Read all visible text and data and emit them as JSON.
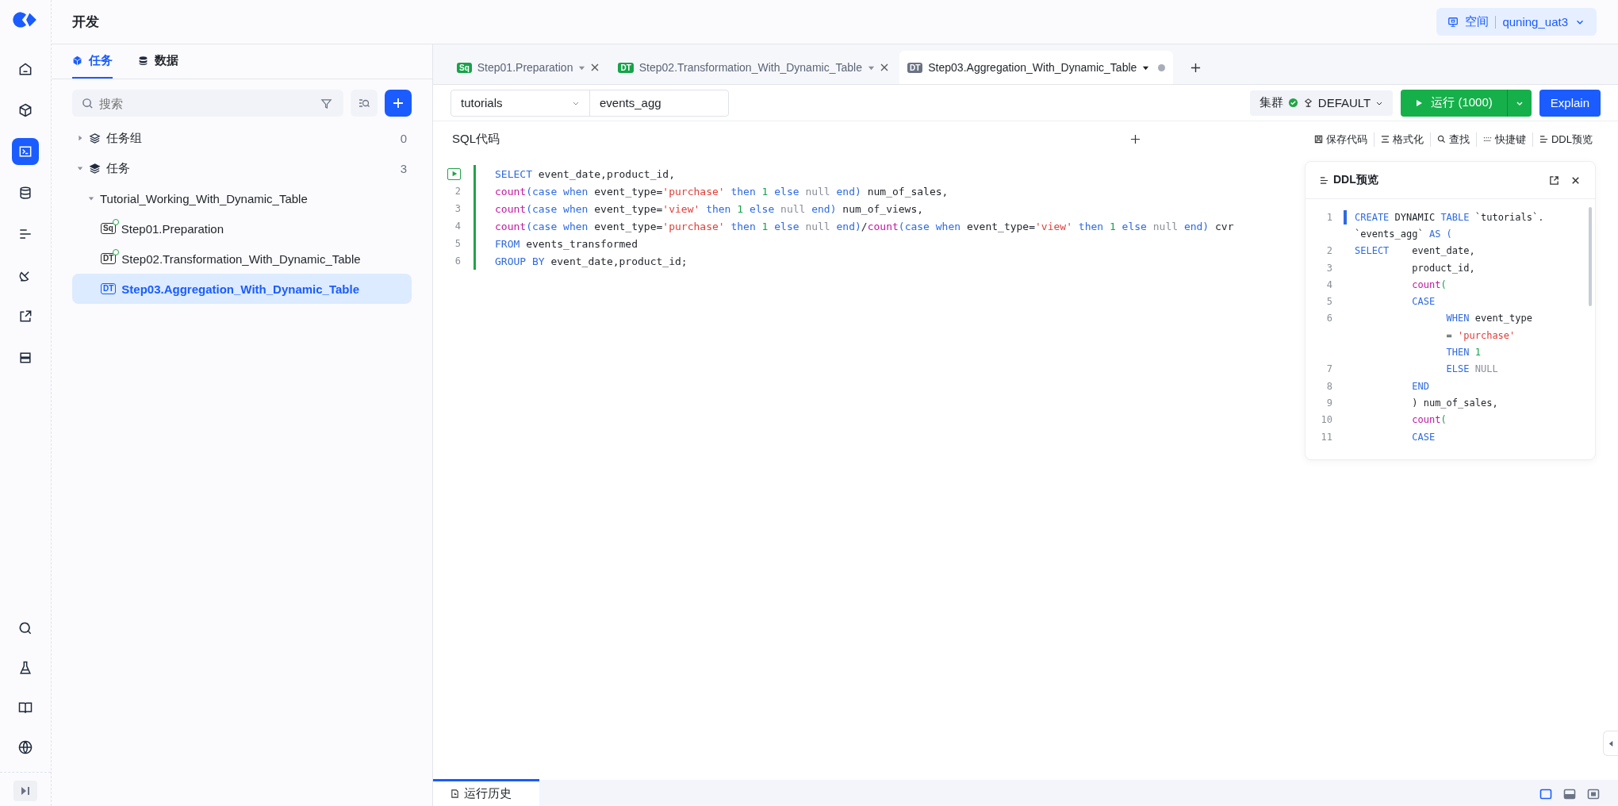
{
  "header": {
    "title": "开发",
    "workspace_label": "空间",
    "workspace_user": "quning_uat3"
  },
  "rail": [
    {
      "selected": false
    },
    {
      "selected": false
    },
    {
      "selected": true
    },
    {
      "selected": false
    },
    {
      "selected": false
    },
    {
      "selected": false
    },
    {
      "selected": false
    },
    {
      "selected": false
    }
  ],
  "rail_bottom": [
    {
      "selected": false
    },
    {
      "selected": false
    },
    {
      "selected": false
    },
    {
      "selected": false
    }
  ],
  "panel_tabs": [
    {
      "label": "任务",
      "selected": true
    },
    {
      "label": "数据",
      "selected": false
    }
  ],
  "search": {
    "placeholder": "搜索"
  },
  "tree": [
    {
      "label": "任务组",
      "count": "0",
      "expanded": false
    },
    {
      "label": "任务",
      "count": "3",
      "expanded": true,
      "children": [
        {
          "label": "Tutorial_Working_With_Dynamic_Table",
          "expanded": true,
          "children": [
            {
              "badge": "Sq",
              "label": "Step01.Preparation",
              "synced": true,
              "selected": false
            },
            {
              "badge": "DT",
              "label": "Step02.Transformation_With_Dynamic_Table",
              "synced": true,
              "selected": false
            },
            {
              "badge": "DT",
              "label": "Step03.Aggregation_With_Dynamic_Table",
              "synced": false,
              "selected": true
            }
          ]
        }
      ]
    }
  ],
  "editor_tabs": [
    {
      "badge": "Sq",
      "label": "Step01.Preparation",
      "selected": false,
      "modified": false
    },
    {
      "badge": "DT",
      "label": "Step02.Transformation_With_Dynamic_Table",
      "selected": false,
      "modified": false
    },
    {
      "badge": "DT",
      "label": "Step03.Aggregation_With_Dynamic_Table",
      "selected": true,
      "modified": true
    }
  ],
  "toolbar": {
    "schema": "tutorials",
    "table": "events_agg",
    "cluster_label": "集群",
    "cluster": "DEFAULT",
    "run": "运行 (1000)",
    "explain": "Explain"
  },
  "sql": {
    "title": "SQL代码",
    "actions": [
      "保存代码",
      "格式化",
      "查找",
      "快捷键",
      "DDL预览"
    ]
  },
  "code": [
    {
      "tokens": [
        {
          "kind": "kw",
          "text": "SELECT"
        },
        {
          "kind": "plain",
          "text": " event_date,product_id,"
        }
      ]
    },
    {
      "number": "2",
      "tokens": [
        {
          "kind": "fn",
          "text": "count"
        },
        {
          "kind": "kw",
          "text": "(case when"
        },
        {
          "kind": "plain",
          "text": " event_type="
        },
        {
          "kind": "str",
          "text": "'purchase'"
        },
        {
          "kind": "kw",
          "text": " then"
        },
        {
          "kind": "num",
          "text": " 1"
        },
        {
          "kind": "kw",
          "text": " else"
        },
        {
          "kind": "null",
          "text": " null"
        },
        {
          "kind": "kw",
          "text": " end)"
        },
        {
          "kind": "plain",
          "text": " num_of_sales,"
        }
      ]
    },
    {
      "number": "3",
      "tokens": [
        {
          "kind": "fn",
          "text": "count"
        },
        {
          "kind": "kw",
          "text": "(case when"
        },
        {
          "kind": "plain",
          "text": " event_type="
        },
        {
          "kind": "str",
          "text": "'view'"
        },
        {
          "kind": "kw",
          "text": " then"
        },
        {
          "kind": "num",
          "text": " 1"
        },
        {
          "kind": "kw",
          "text": " else"
        },
        {
          "kind": "null",
          "text": " null"
        },
        {
          "kind": "kw",
          "text": " end)"
        },
        {
          "kind": "plain",
          "text": " num_of_views,"
        }
      ]
    },
    {
      "number": "4",
      "tokens": [
        {
          "kind": "fn",
          "text": "count"
        },
        {
          "kind": "kw",
          "text": "(case when"
        },
        {
          "kind": "plain",
          "text": " event_type="
        },
        {
          "kind": "str",
          "text": "'purchase'"
        },
        {
          "kind": "kw",
          "text": " then"
        },
        {
          "kind": "num",
          "text": " 1"
        },
        {
          "kind": "kw",
          "text": " else"
        },
        {
          "kind": "null",
          "text": " null"
        },
        {
          "kind": "kw",
          "text": " end)"
        },
        {
          "kind": "plain",
          "text": "/"
        },
        {
          "kind": "fn",
          "text": "count"
        },
        {
          "kind": "kw",
          "text": "(case when"
        },
        {
          "kind": "plain",
          "text": " event_type="
        },
        {
          "kind": "str",
          "text": "'view'"
        },
        {
          "kind": "kw",
          "text": " then"
        },
        {
          "kind": "num",
          "text": " 1"
        },
        {
          "kind": "kw",
          "text": " else"
        },
        {
          "kind": "null",
          "text": " null"
        },
        {
          "kind": "kw",
          "text": " end)"
        },
        {
          "kind": "plain",
          "text": " cvr"
        }
      ]
    },
    {
      "number": "5",
      "tokens": [
        {
          "kind": "kw",
          "text": "FROM"
        },
        {
          "kind": "plain",
          "text": " events_transformed"
        }
      ]
    },
    {
      "number": "6",
      "tokens": [
        {
          "kind": "kw",
          "text": "GROUP BY"
        },
        {
          "kind": "plain",
          "text": " event_date,product_id;"
        }
      ]
    }
  ],
  "ddl": {
    "title": "DDL预览",
    "lines": [
      {
        "number": "1",
        "tokens": [
          {
            "kind": "kw",
            "text": "CREATE"
          },
          {
            "kind": "plain",
            "text": " DYNAMIC "
          },
          {
            "kind": "kw",
            "text": "TABLE"
          },
          {
            "kind": "plain",
            "text": " `tutorials`."
          }
        ]
      },
      {
        "tokens": [
          {
            "kind": "plain",
            "text": "`events_agg` "
          },
          {
            "kind": "kw",
            "text": "AS ("
          }
        ]
      },
      {
        "number": "2",
        "tokens": [
          {
            "kind": "kw",
            "text": "SELECT"
          },
          {
            "kind": "plain",
            "text": "    event_date,"
          }
        ]
      },
      {
        "number": "3",
        "tokens": [
          {
            "kind": "plain",
            "text": "          product_id,"
          }
        ]
      },
      {
        "number": "4",
        "tokens": [
          {
            "kind": "fn",
            "text": "          count"
          },
          {
            "kind": "num",
            "text": "("
          }
        ]
      },
      {
        "number": "5",
        "tokens": [
          {
            "kind": "kw",
            "text": "          CASE"
          }
        ]
      },
      {
        "number": "6",
        "tokens": [
          {
            "kind": "kw",
            "text": "                WHEN"
          },
          {
            "kind": "plain",
            "text": " event_type"
          }
        ]
      },
      {
        "tokens": [
          {
            "kind": "plain",
            "text": "                = "
          },
          {
            "kind": "str",
            "text": "'purchase'"
          }
        ]
      },
      {
        "tokens": [
          {
            "kind": "kw",
            "text": "                THEN"
          },
          {
            "kind": "num",
            "text": " 1"
          }
        ]
      },
      {
        "number": "7",
        "tokens": [
          {
            "kind": "kw",
            "text": "                ELSE"
          },
          {
            "kind": "null",
            "text": " NULL"
          }
        ]
      },
      {
        "number": "8",
        "tokens": [
          {
            "kind": "kw",
            "text": "          END"
          }
        ]
      },
      {
        "number": "9",
        "tokens": [
          {
            "kind": "plain",
            "text": "          ) num_of_sales,"
          }
        ]
      },
      {
        "number": "10",
        "tokens": [
          {
            "kind": "fn",
            "text": "          count"
          },
          {
            "kind": "num",
            "text": "("
          }
        ]
      },
      {
        "number": "11",
        "tokens": [
          {
            "kind": "kw",
            "text": "          CASE"
          }
        ]
      }
    ]
  },
  "bottom_tabs": [
    {
      "label": "运行历史",
      "selected": true
    }
  ],
  "layout_buttons": [
    {
      "selected": true
    },
    {
      "selected": false
    },
    {
      "selected": false
    }
  ]
}
